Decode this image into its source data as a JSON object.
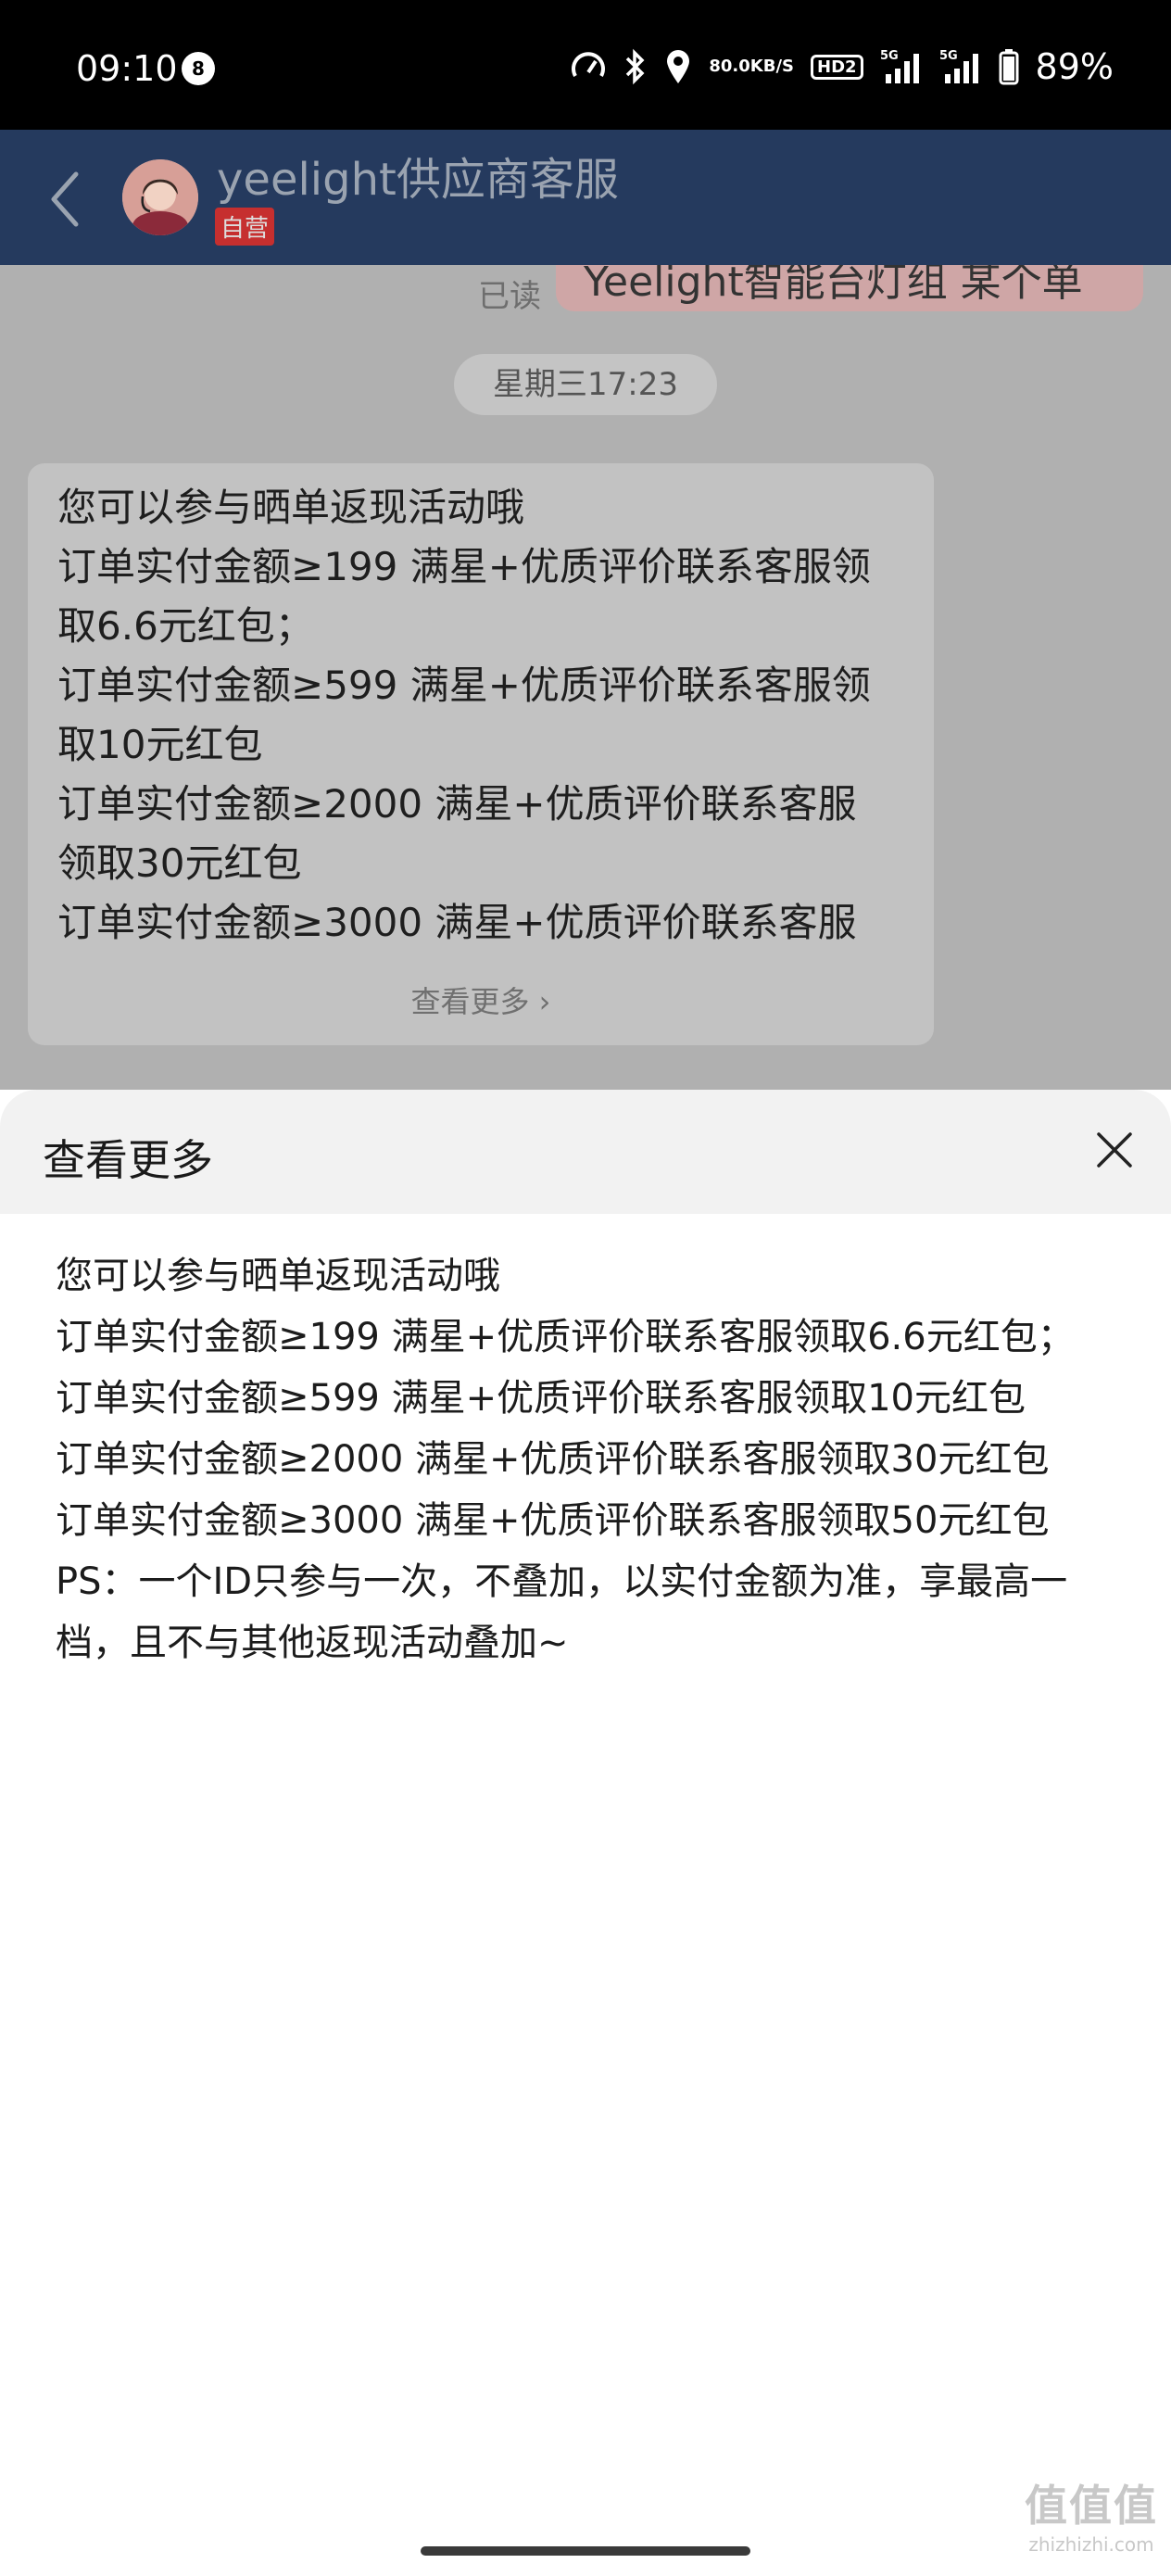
{
  "status_bar": {
    "time": "09:10",
    "notification_count": "8",
    "net_speed_value": "80.0",
    "net_speed_unit": "KB/S",
    "hd_label": "HD2",
    "sig1_label": "5G",
    "sig2_label": "5G",
    "battery": "89%"
  },
  "header": {
    "title": "yeelight供应商客服",
    "badge": "自营"
  },
  "chat": {
    "prev_message": "Yeelight智能台灯组 某个单",
    "read_status": "已读",
    "timestamp": "星期三17:23",
    "message": {
      "lines": [
        "您可以参与晒单返现活动哦",
        "订单实付金额≥199  满星+优质评价联系客服领",
        "取6.6元红包；",
        "订单实付金额≥599  满星+优质评价联系客服领",
        "取10元红包",
        "订单实付金额≥2000  满星+优质评价联系客服",
        "领取30元红包",
        "订单实付金额≥3000  满星+优质评价联系客服"
      ],
      "more_label": "查看更多 ›"
    }
  },
  "sheet": {
    "title": "查看更多",
    "lines": [
      "您可以参与晒单返现活动哦",
      "订单实付金额≥199  满星+优质评价联系客服领取6.6元红包；",
      "订单实付金额≥599  满星+优质评价联系客服领取10元红包",
      "订单实付金额≥2000  满星+优质评价联系客服领取30元红包",
      "订单实付金额≥3000  满星+优质评价联系客服领取50元红包",
      "PS：一个ID只参与一次，不叠加，以实付金额为准，享最高一",
      "档，且不与其他返现活动叠加~"
    ]
  },
  "watermark": {
    "logo": "值值值",
    "url": "zhizhizhi.com"
  },
  "colors": {
    "header_bg": "#253a5e",
    "badge_red": "#c62f2f",
    "overlay_gray": "#b0b0b0"
  }
}
